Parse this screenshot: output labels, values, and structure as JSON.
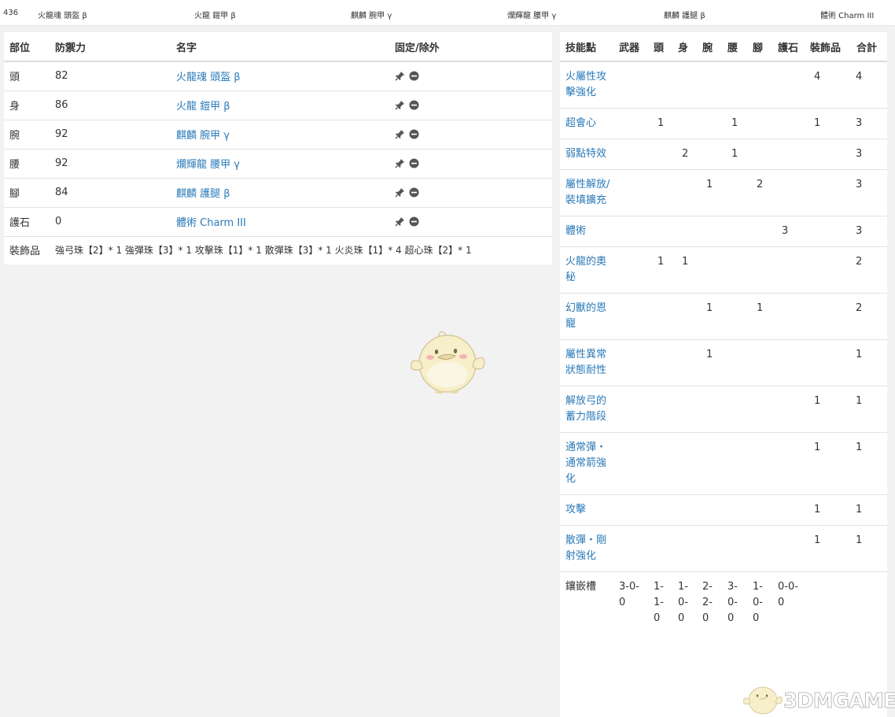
{
  "topbar": {
    "defense_total": "436",
    "items": [
      "火龍魂 頭盔 β",
      "火龍 鎧甲 β",
      "麒麟 腕甲 γ",
      "爛輝龍 腰甲 γ",
      "麒麟 護腿 β",
      "體術 Charm III"
    ]
  },
  "equipment": {
    "headers": [
      "部位",
      "防禦力",
      "名字",
      "固定/除外"
    ],
    "rows": [
      {
        "part": "頭",
        "defense": "82",
        "name": "火龍魂 頭盔 β"
      },
      {
        "part": "身",
        "defense": "86",
        "name": "火龍 鎧甲 β"
      },
      {
        "part": "腕",
        "defense": "92",
        "name": "麒麟 腕甲 γ"
      },
      {
        "part": "腰",
        "defense": "92",
        "name": "爛輝龍 腰甲 γ"
      },
      {
        "part": "腳",
        "defense": "84",
        "name": "麒麟 護腿 β"
      },
      {
        "part": "護石",
        "defense": "0",
        "name": "體術 Charm III"
      }
    ],
    "decoration_label": "裝飾品",
    "decorations": "強弓珠【2】* 1 強彈珠【3】* 1 攻擊珠【1】* 1 散彈珠【3】* 1 火炎珠【1】* 4 超心珠【2】* 1",
    "icons": {
      "pin": "pin-icon",
      "exclude": "minus-circle-icon"
    }
  },
  "skills": {
    "headers": [
      "技能點",
      "武器",
      "頭",
      "身",
      "腕",
      "腰",
      "腳",
      "護石",
      "裝飾品",
      "合計"
    ],
    "rows": [
      {
        "name": "火屬性攻擊強化",
        "vals": [
          "",
          "",
          "",
          "",
          "",
          "",
          "",
          "4",
          "4"
        ]
      },
      {
        "name": "超會心",
        "vals": [
          "",
          "1",
          "",
          "",
          "1",
          "",
          "",
          "1",
          "3"
        ]
      },
      {
        "name": "弱點特效",
        "vals": [
          "",
          "",
          "2",
          "",
          "1",
          "",
          "",
          "",
          "3"
        ]
      },
      {
        "name": "屬性解放/裝填擴充",
        "vals": [
          "",
          "",
          "",
          "1",
          "",
          "2",
          "",
          "",
          "3"
        ]
      },
      {
        "name": "體術",
        "vals": [
          "",
          "",
          "",
          "",
          "",
          "",
          "3",
          "",
          "3"
        ]
      },
      {
        "name": "火龍的奧秘",
        "vals": [
          "",
          "1",
          "1",
          "",
          "",
          "",
          "",
          "",
          "2"
        ]
      },
      {
        "name": "幻獸的恩寵",
        "vals": [
          "",
          "",
          "",
          "1",
          "",
          "1",
          "",
          "",
          "2"
        ]
      },
      {
        "name": "屬性異常狀態耐性",
        "vals": [
          "",
          "",
          "",
          "1",
          "",
          "",
          "",
          "",
          "1"
        ]
      },
      {
        "name": "解放弓的蓄力階段",
        "vals": [
          "",
          "",
          "",
          "",
          "",
          "",
          "",
          "1",
          "1"
        ]
      },
      {
        "name": "通常彈・通常箭強化",
        "vals": [
          "",
          "",
          "",
          "",
          "",
          "",
          "",
          "1",
          "1"
        ]
      },
      {
        "name": "攻擊",
        "vals": [
          "",
          "",
          "",
          "",
          "",
          "",
          "",
          "1",
          "1"
        ]
      },
      {
        "name": "散彈・剛射強化",
        "vals": [
          "",
          "",
          "",
          "",
          "",
          "",
          "",
          "1",
          "1"
        ]
      }
    ],
    "slots_label": "鑲嵌槽",
    "slots": [
      "3-0-0",
      "1-1-0",
      "1-0-0",
      "2-2-0",
      "3-0-0",
      "1-0-0",
      "0-0-0",
      "",
      ""
    ]
  },
  "watermark": "3DMGAME",
  "colors": {
    "link": "#2a7ab8",
    "background": "#f2f2f2",
    "panel": "#ffffff"
  }
}
